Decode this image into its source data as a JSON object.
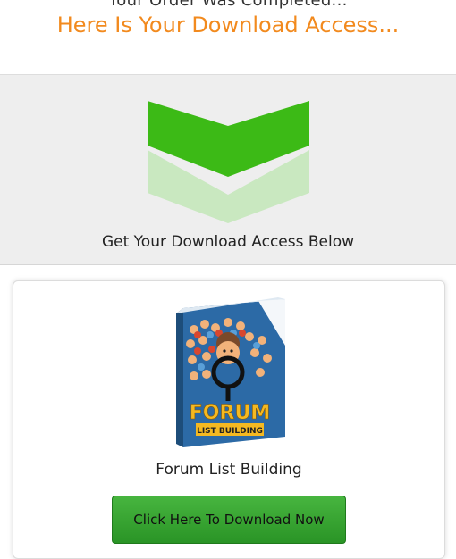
{
  "header": {
    "partial_line": "Your Order Was Completed...",
    "headline": "Here Is Your Download Access..."
  },
  "banner": {
    "arrow_icon": "chevron-down-icon",
    "text": "Get Your Download Access Below"
  },
  "product": {
    "cover_title_line1": "FORUM",
    "cover_title_line2": "LIST BUILDING",
    "title": "Forum List Building",
    "button_label": "Click Here To Download Now"
  },
  "colors": {
    "headline": "#f28a1e",
    "arrow_dark": "#3cba16",
    "arrow_light": "#c9e8c0",
    "button": "#3aa532"
  }
}
